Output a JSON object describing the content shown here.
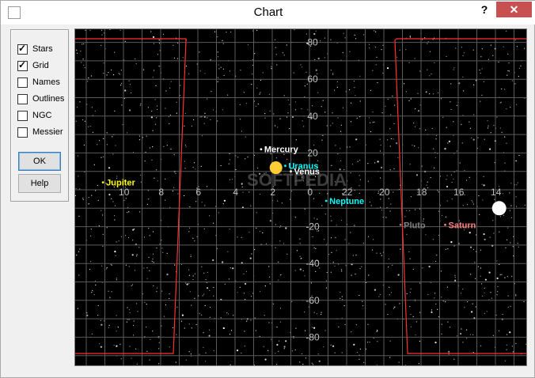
{
  "window": {
    "title": "Chart",
    "help_glyph": "?",
    "close_glyph": "✕"
  },
  "options": [
    {
      "label": "Stars",
      "checked": true
    },
    {
      "label": "Grid",
      "checked": true
    },
    {
      "label": "Names",
      "checked": false
    },
    {
      "label": "Outlines",
      "checked": false
    },
    {
      "label": "NGC",
      "checked": false
    },
    {
      "label": "Messier",
      "checked": false
    }
  ],
  "buttons": {
    "ok": "OK",
    "help": "Help"
  },
  "chart_data": {
    "type": "scatter",
    "x_ticks": [
      "10",
      "8",
      "6",
      "4",
      "2",
      "0",
      "22",
      "20",
      "18",
      "16",
      "14"
    ],
    "y_ticks": [
      "80",
      "60",
      "40",
      "20",
      "-20",
      "-40",
      "-60",
      "-80"
    ],
    "watermark": "SOFTPEDIA",
    "bodies": [
      {
        "name": "Mercury",
        "color": "#ffffff",
        "ra": 2.8,
        "dec": 22
      },
      {
        "name": "Venus",
        "color": "#ffffff",
        "ra": 1.2,
        "dec": 10
      },
      {
        "name": "Uranus",
        "color": "#00ffff",
        "ra": 1.5,
        "dec": 13
      },
      {
        "name": "Neptune",
        "color": "#00ffff",
        "ra": 23.3,
        "dec": -6
      },
      {
        "name": "Pluto",
        "color": "#808080",
        "ra": 19.3,
        "dec": -19
      },
      {
        "name": "Saturn",
        "color": "#ff8080",
        "ra": 16.9,
        "dec": -19
      },
      {
        "name": "Jupiter",
        "color": "#ffff00",
        "ra": 11.3,
        "dec": 4
      }
    ],
    "sun": {
      "ra": 2.0,
      "dec": 12,
      "color": "#ffcc33"
    },
    "moon": {
      "ra": 14.0,
      "dec": -10,
      "color": "#ffffff"
    },
    "grid": true,
    "stars": true,
    "horizon_color": "#ff3030"
  }
}
